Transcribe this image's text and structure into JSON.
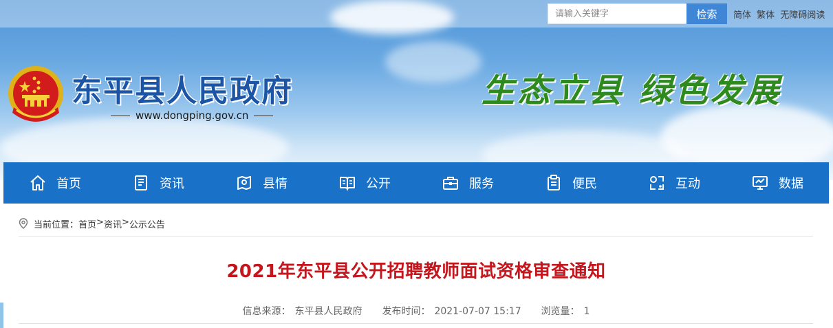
{
  "header": {
    "search": {
      "placeholder": "请输入关键字",
      "button_label": "检索"
    },
    "top_links": [
      "简体",
      "繁体",
      "无障碍阅读"
    ],
    "site_name": "东平县人民政府",
    "site_url": "www.dongping.gov.cn",
    "slogan": "生态立县 绿色发展"
  },
  "nav": {
    "items": [
      {
        "label": "首页",
        "icon": "home-icon"
      },
      {
        "label": "资讯",
        "icon": "news-icon"
      },
      {
        "label": "县情",
        "icon": "map-icon"
      },
      {
        "label": "公开",
        "icon": "book-icon"
      },
      {
        "label": "服务",
        "icon": "briefcase-icon"
      },
      {
        "label": "便民",
        "icon": "clipboard-icon"
      },
      {
        "label": "互动",
        "icon": "interact-icon"
      },
      {
        "label": "数据",
        "icon": "monitor-icon"
      }
    ]
  },
  "breadcrumb": {
    "prefix": "当前位置：",
    "items": [
      "首页",
      "资讯",
      "公示公告"
    ],
    "separator": ">"
  },
  "article": {
    "title": "2021年东平县公开招聘教师面试资格审查通知",
    "source_label": "信息来源：",
    "source": "东平县人民政府",
    "time_label": "发布时间：",
    "time": "2021-07-07 15:17",
    "views_label": "浏览量：",
    "views": "1"
  },
  "colors": {
    "nav_bg": "#1a71c8",
    "title_red": "#c4161c",
    "site_blue": "#1d55a6",
    "slogan_green": "#2e8a1e"
  }
}
